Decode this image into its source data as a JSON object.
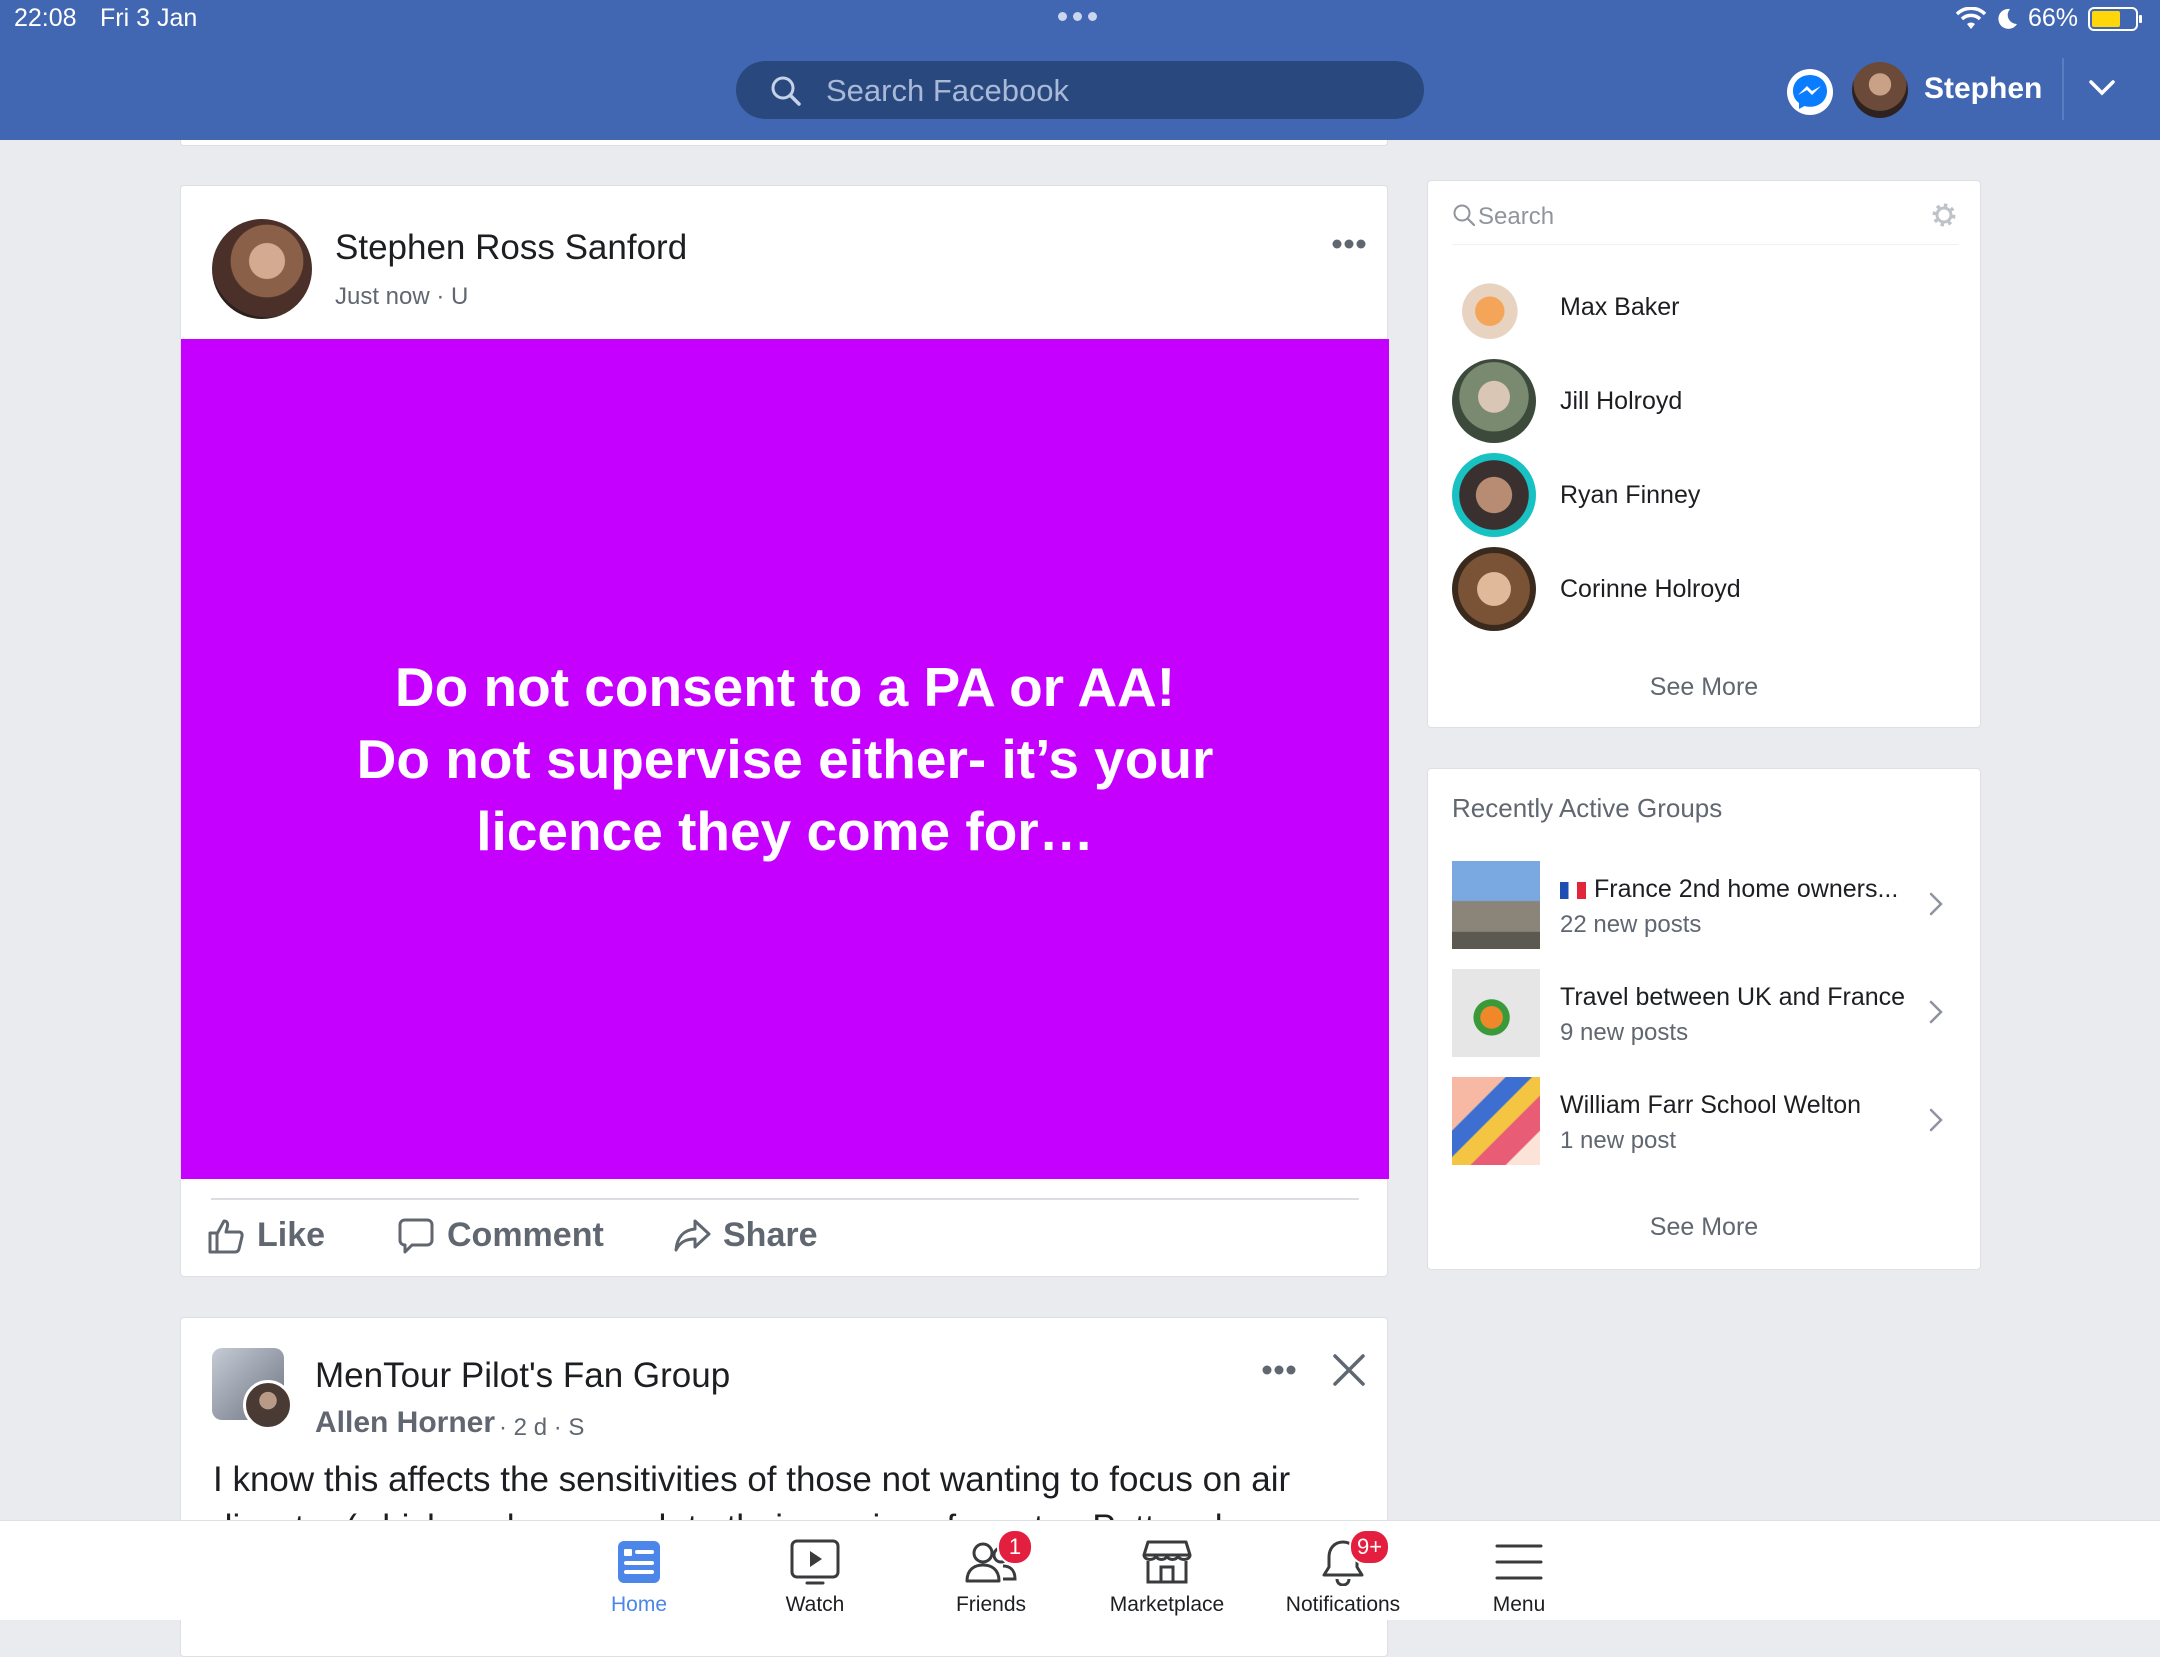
{
  "status_bar": {
    "time": "22:08",
    "date": "Fri 3 Jan",
    "battery": "66%",
    "battery_level": 0.66
  },
  "header": {
    "search_placeholder": "Search Facebook",
    "user_name": "Stephen",
    "brand_color": "#4267b2"
  },
  "post1": {
    "author": "Stephen Ross Sanford",
    "time": "Just now",
    "audience": "U",
    "text_lines": [
      "Do not consent to a PA or AA!",
      "Do not supervise either- it’s your",
      "licence they come for…"
    ],
    "background_color": "#c600ff",
    "actions": {
      "like": "Like",
      "comment": "Comment",
      "share": "Share"
    }
  },
  "post2": {
    "group_name": "MenTour Pilot's Fan Group",
    "author": "Allen Horner",
    "time": "2 d",
    "audience": "S",
    "text": "I know this affects the sensitivities of those not wanting to focus on air disaster (which perhaps much to their suprise of mentor. Potter, does"
  },
  "contacts": {
    "search_placeholder": "Search",
    "items": [
      {
        "name": "Max Baker"
      },
      {
        "name": "Jill Holroyd"
      },
      {
        "name": "Ryan Finney"
      },
      {
        "name": "Corinne Holroyd"
      }
    ],
    "see_more": "See More"
  },
  "groups": {
    "title": "Recently Active Groups",
    "items": [
      {
        "name": "France 2nd home owners...",
        "posts": "22 new posts",
        "flag": "france-flag-icon"
      },
      {
        "name": "Travel between UK and France",
        "posts": "9 new posts"
      },
      {
        "name": "William Farr School Welton",
        "posts": "1 new post"
      }
    ],
    "see_more": "See More"
  },
  "tabbar": {
    "tabs": [
      {
        "label": "Home",
        "icon": "home-feed-icon",
        "active": true
      },
      {
        "label": "Watch",
        "icon": "watch-icon"
      },
      {
        "label": "Friends",
        "icon": "friends-icon",
        "badge": "1"
      },
      {
        "label": "Marketplace",
        "icon": "marketplace-icon"
      },
      {
        "label": "Notifications",
        "icon": "bell-icon",
        "badge": "9+"
      },
      {
        "label": "Menu",
        "icon": "menu-icon"
      }
    ]
  }
}
